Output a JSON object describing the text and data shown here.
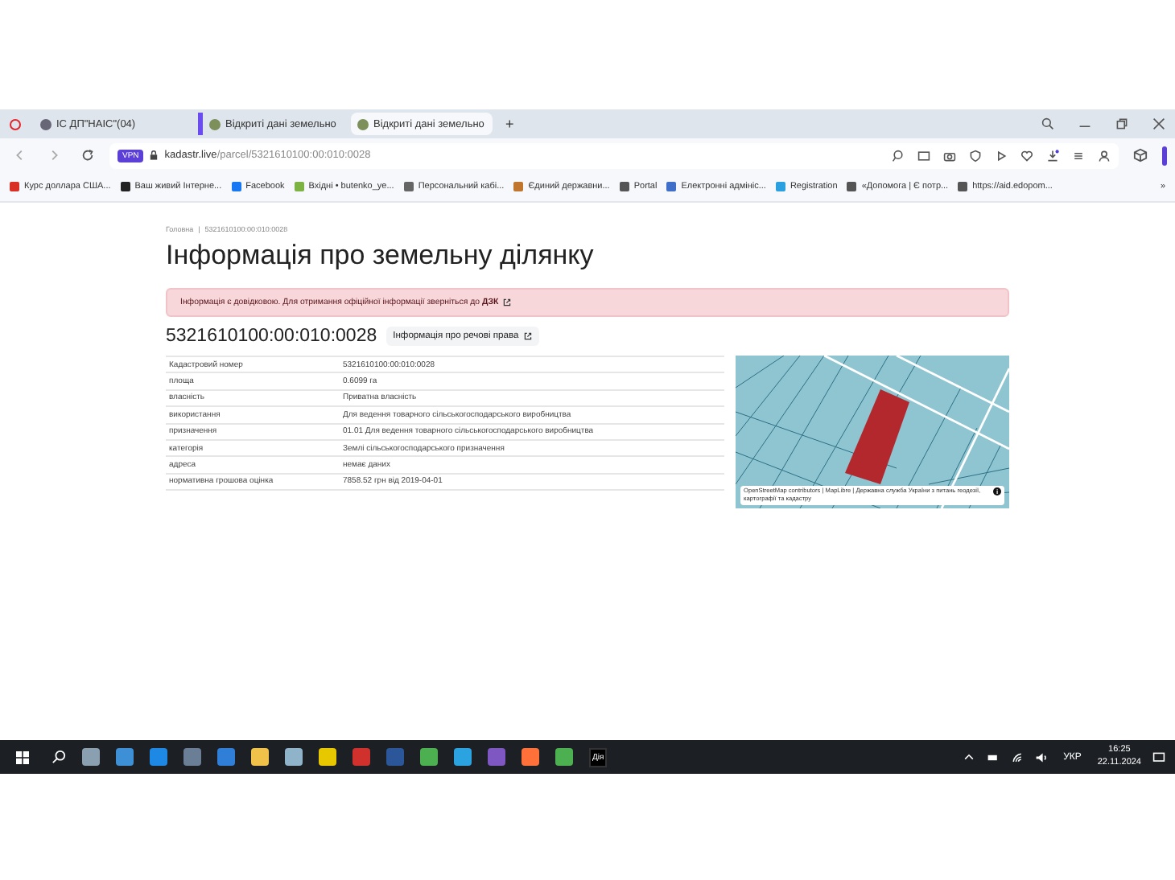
{
  "browser": {
    "tabs": [
      {
        "label": "ІС ДП\"НАІС\"(04)",
        "selected": false,
        "kind": "globe"
      },
      {
        "label": "Відкриті дані земельно",
        "selected": false,
        "kind": "site"
      },
      {
        "label": "Відкриті дані земельно",
        "selected": true,
        "kind": "site"
      }
    ],
    "new_tab": "+",
    "vpn": "VPN",
    "url_host": "kadastr.live",
    "url_path": "/parcel/5321610100:00:010:0028",
    "bookmarks": [
      {
        "label": "Курс доллара США...",
        "color": "#d93025"
      },
      {
        "label": "Ваш живий Інтерне...",
        "color": "#222222"
      },
      {
        "label": "Facebook",
        "color": "#1877f2"
      },
      {
        "label": "Вхідні • butenko_ye...",
        "color": "#7cb342"
      },
      {
        "label": "Персональний кабі...",
        "color": "#666666"
      },
      {
        "label": "Єдиний державни...",
        "color": "#c0762c"
      },
      {
        "label": "Portal",
        "color": "#555555"
      },
      {
        "label": "Електронні адмініс...",
        "color": "#3f6fc8"
      },
      {
        "label": "Registration",
        "color": "#2aa0e0"
      },
      {
        "label": "«Допомога | Є потр...",
        "color": "#555555"
      },
      {
        "label": "https://aid.edopom...",
        "color": "#555555"
      }
    ],
    "more": "»"
  },
  "page": {
    "breadcrumb_home": "Головна",
    "breadcrumb_separator": "|",
    "breadcrumb_current": "5321610100:00:010:0028",
    "title": "Інформація про земельну ділянку",
    "notice": "Інформація є довідковою. Для отримання офіційної інформації зверніться до **ДЗК**",
    "cadastral_number": "5321610100:00:010:0028",
    "rights_button": "Інформація про речові права",
    "table": {
      "rows": [
        {
          "label": "Кадастровий номер",
          "value": "5321610100:00:010:0028"
        },
        {
          "label": "площа",
          "value": "0.6099 га"
        },
        {
          "label": "власність",
          "value": "Приватна власність"
        },
        {
          "label": "використання",
          "value": "Для ведення товарного сільськогосподарського виробництва"
        },
        {
          "label": "призначення",
          "value": "01.01 Для ведення товарного сільськогосподарського виробництва"
        },
        {
          "label": "категорія",
          "value": "Землі сільськогосподарського призначення"
        },
        {
          "label": "адреса",
          "value": "немає даних"
        },
        {
          "label": "нормативна грошова оцінка",
          "value": "7858.52 грн від 2019-04-01"
        }
      ]
    },
    "map": {
      "attribution_osm": "OpenStreetMap contributors",
      "attribution_mid": "| MapLibre",
      "attribution_rest": "| Державна служба України з питань геодезії, картографії та кадастру",
      "info": "i"
    }
  },
  "taskbar": {
    "apps": [
      {
        "kind": "search"
      },
      {
        "kind": "app",
        "color": "#8aa0b0"
      },
      {
        "kind": "app",
        "color": "#3d8fd6"
      },
      {
        "kind": "app",
        "color": "#1e88e5"
      },
      {
        "kind": "app",
        "color": "#6a7f95"
      },
      {
        "kind": "app",
        "color": "#2f7ed8"
      },
      {
        "kind": "app",
        "color": "#f0c24a"
      },
      {
        "kind": "app",
        "color": "#8fb3c8"
      },
      {
        "kind": "app",
        "color": "#e6c700"
      },
      {
        "kind": "app",
        "color": "#d0312d"
      },
      {
        "kind": "app",
        "color": "#2b579a"
      },
      {
        "kind": "app",
        "color": "#4caf50"
      },
      {
        "kind": "app",
        "color": "#2aa3e0"
      },
      {
        "kind": "app",
        "color": "#7e57c2"
      },
      {
        "kind": "app",
        "color": "#ff7139"
      },
      {
        "kind": "app",
        "color": "#4caf50"
      },
      {
        "kind": "label",
        "text": "Дія"
      }
    ],
    "language": "УКР",
    "time": "16:25",
    "date": "22.11.2024"
  }
}
